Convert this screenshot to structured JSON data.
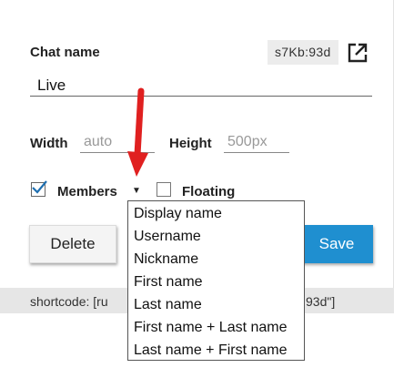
{
  "form": {
    "chat_name_label": "Chat name",
    "chat_id": "s7Kb:93d",
    "chat_name_value": "Live",
    "width_label": "Width",
    "width_placeholder": "auto",
    "height_label": "Height",
    "height_placeholder": "500px",
    "members_label": "Members",
    "members_checked": true,
    "floating_label": "Floating",
    "floating_checked": false,
    "caret": "▼",
    "delete_label": "Delete",
    "save_label": "Save"
  },
  "footer": {
    "shortcode_visible_left": "shortcode: [ru",
    "shortcode_visible_right": "93d\"]"
  },
  "members_dropdown": {
    "options": [
      "Display name",
      "Username",
      "Nickname",
      "First name",
      "Last name",
      "First name + Last name",
      "Last name + First name"
    ]
  },
  "colors": {
    "accent": "#1f8fd0",
    "annotation_arrow": "#e02020",
    "footer_bg": "#e6e6e6",
    "id_badge_bg": "#ececec"
  },
  "icons": {
    "open": "external-link-icon",
    "checkbox_check": "check-icon",
    "annotation": "red-arrow-icon"
  }
}
